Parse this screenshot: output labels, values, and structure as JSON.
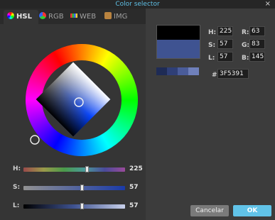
{
  "window": {
    "title": "Color selector",
    "close_glyph": "×"
  },
  "tabs": [
    {
      "label": "HSL",
      "icon": "hsl-wheel-icon",
      "active": true
    },
    {
      "label": "RGB",
      "icon": "rgb-circles-icon",
      "active": false
    },
    {
      "label": "WEB",
      "icon": "web-palette-icon",
      "active": false
    },
    {
      "label": "IMG",
      "icon": "image-icon",
      "active": false
    }
  ],
  "sliders": {
    "h": {
      "label": "H:",
      "value": "225",
      "fraction": 0.625
    },
    "s": {
      "label": "S:",
      "value": "57",
      "fraction": 0.57
    },
    "l": {
      "label": "L:",
      "value": "57",
      "fraction": 0.57
    }
  },
  "fields": {
    "h": {
      "label": "H:",
      "value": "225"
    },
    "s": {
      "label": "S:",
      "value": "57"
    },
    "l": {
      "label": "L:",
      "value": "57"
    },
    "r": {
      "label": "R:",
      "value": "63"
    },
    "g": {
      "label": "G:",
      "value": "83"
    },
    "b": {
      "label": "B:",
      "value": "145"
    },
    "hex": {
      "label": "#",
      "value": "3F5391"
    }
  },
  "colors": {
    "current": "#3F5391",
    "previous": "#000000",
    "palette": [
      "#1e2b55",
      "#2f3f77",
      "#4a5c9a",
      "#6f80bb"
    ],
    "accent": "#61c3e8"
  },
  "buttons": {
    "cancel": "Cancelar",
    "ok": "OK"
  }
}
